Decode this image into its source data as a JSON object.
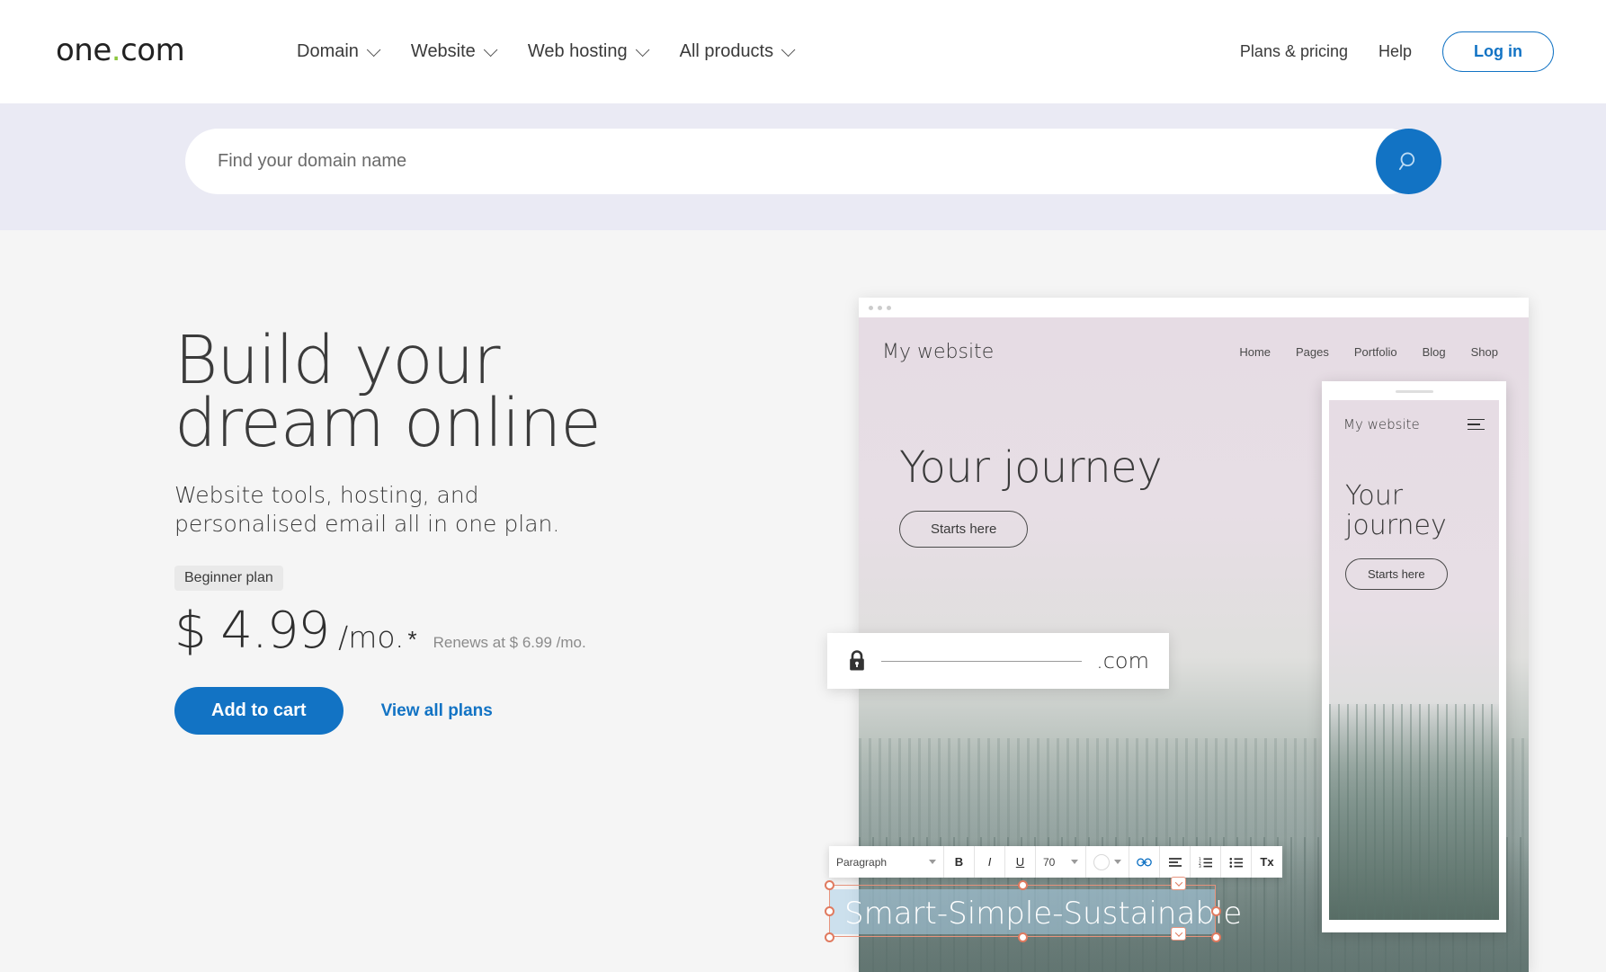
{
  "header": {
    "logo": {
      "text": "one",
      "dot": ".",
      "suffix": "com"
    },
    "nav": [
      {
        "label": "Domain",
        "icon": "chevron-down-icon"
      },
      {
        "label": "Website",
        "icon": "chevron-down-icon"
      },
      {
        "label": "Web hosting",
        "icon": "chevron-down-icon"
      },
      {
        "label": "All products",
        "icon": "chevron-down-icon"
      }
    ],
    "plans_pricing": "Plans & pricing",
    "help": "Help",
    "login": "Log in",
    "accent_color": "#1273c4",
    "logo_dot_color": "#8cc63e"
  },
  "search": {
    "placeholder": "Find your domain name",
    "value": "",
    "button_icon": "search-icon",
    "band_color": "#eaeaf4",
    "button_color": "#1273c4"
  },
  "hero": {
    "title_line1": "Build your",
    "title_line2": "dream online",
    "subtitle_line1": "Website tools, hosting, and",
    "subtitle_line2": "personalised email all in one plan.",
    "plan_badge": "Beginner plan",
    "price": "$ 4.99",
    "price_period": "/mo.",
    "price_star": "*",
    "renewal": "Renews at $ 6.99 /mo.",
    "add_to_cart": "Add to cart",
    "view_all_plans": "View all plans"
  },
  "mockup": {
    "browser": {
      "site_title": "My website",
      "nav": [
        "Home",
        "Pages",
        "Portfolio",
        "Blog",
        "Shop"
      ],
      "hero_title": "Your journey",
      "hero_button": "Starts here"
    },
    "domain_card": {
      "lock_icon": "lock-icon",
      "domain_value": "",
      "tld": ".com"
    },
    "editor_toolbar": {
      "paragraph_label": "Paragraph",
      "bold": "B",
      "italic": "I",
      "underline": "U",
      "font_size": "70",
      "color_swatch": "#ffffff",
      "link_icon": "link-icon",
      "align_icon": "align-left-icon",
      "ordered_list_icon": "ordered-list-icon",
      "unordered_list_icon": "unordered-list-icon",
      "clear_format": "Tx"
    },
    "selected_text": "Smart-Simple-Sustainable",
    "selection_handle_color": "#e07a5f",
    "phone": {
      "site_title": "My website",
      "menu_icon": "hamburger-menu-icon",
      "hero_title_line1": "Your",
      "hero_title_line2": "journey",
      "hero_button": "Starts here"
    }
  }
}
